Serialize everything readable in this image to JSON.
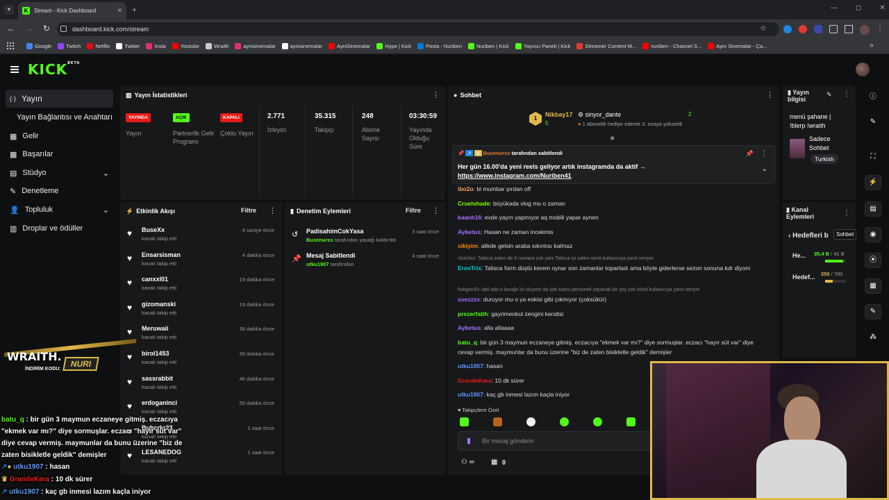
{
  "browser": {
    "tab_title": "Stream - Kick Dashboard",
    "url": "dashboard.kick.com/stream",
    "bookmarks": [
      {
        "label": "Google",
        "color": "#4285f4"
      },
      {
        "label": "Twitch",
        "color": "#9146ff"
      },
      {
        "label": "Netflix",
        "color": "#e50914"
      },
      {
        "label": "Twitter",
        "color": "#ffffff"
      },
      {
        "label": "Insta",
        "color": "#e1306c"
      },
      {
        "label": "Youtube",
        "color": "#ff0000"
      },
      {
        "label": "Wraith",
        "color": "#cccccc"
      },
      {
        "label": "aynisinemalar",
        "color": "#e1306c"
      },
      {
        "label": "aynisinemalar",
        "color": "#ffffff"
      },
      {
        "label": "AyniSinemalar",
        "color": "#ff0000"
      },
      {
        "label": "Hype | Kick",
        "color": "#53fc18"
      },
      {
        "label": "Posta - Nuriben",
        "color": "#0078d4"
      },
      {
        "label": "Nuriben | Kick",
        "color": "#53fc18"
      },
      {
        "label": "Yayıncı Paneli | Kick",
        "color": "#53fc18"
      },
      {
        "label": "Streamer Content M...",
        "color": "#e53935"
      },
      {
        "label": "nuriben - Channel S...",
        "color": "#ff0000"
      },
      {
        "label": "Aynı Sinemalar - Ça...",
        "color": "#ff0000"
      }
    ]
  },
  "app": {
    "logo": "KICK",
    "logo_beta": "BETA"
  },
  "sidebar": {
    "items": [
      {
        "label": "Yayın",
        "icon": "broadcast-icon"
      },
      {
        "label": "Yayın Bağlantısı ve Anahtarı",
        "icon": ""
      },
      {
        "label": "Gelir",
        "icon": "income-icon"
      },
      {
        "label": "Başarılar",
        "icon": "achievements-icon"
      },
      {
        "label": "Stüdyo",
        "icon": "studio-icon"
      },
      {
        "label": "Denetleme",
        "icon": "moderation-icon"
      },
      {
        "label": "Topluluk",
        "icon": "community-icon"
      },
      {
        "label": "Droplar ve ödüller",
        "icon": "drops-icon"
      }
    ]
  },
  "stats": {
    "title": "Yayın İstatistikleri",
    "items": [
      {
        "badge": "YAYINDA",
        "badge_color": "#e91916",
        "label": "Yayın"
      },
      {
        "badge": "AÇIK",
        "badge_color": "#53fc18",
        "label": "Partnerlik Gelir Programı"
      },
      {
        "badge": "KAPALI",
        "badge_color": "#e91916",
        "label": "Çoklu Yayın"
      },
      {
        "value": "2.771",
        "label": "İzleyici"
      },
      {
        "value": "35.315",
        "label": "Takipçi"
      },
      {
        "value": "248",
        "label": "Abone Sayısı"
      },
      {
        "value": "03:30:59",
        "label": "Yayında Olduğu Süre"
      }
    ]
  },
  "activity": {
    "title": "Etkinlik Akışı",
    "filter": "Filtre",
    "sub": "kanalı takip etti",
    "events": [
      {
        "name": "BuseXx",
        "time": "4 saniye önce"
      },
      {
        "name": "Ensarsisman",
        "time": "4 dakika önce"
      },
      {
        "name": "canxxl01",
        "time": "19 dakika önce"
      },
      {
        "name": "gizomanski",
        "time": "19 dakika önce"
      },
      {
        "name": "Meruwaii",
        "time": "38 dakika önce"
      },
      {
        "name": "birol1453",
        "time": "39 dakika önce"
      },
      {
        "name": "sassrabbit",
        "time": "46 dakika önce"
      },
      {
        "name": "erdoganinci",
        "time": "55 dakika önce"
      },
      {
        "name": "Buhcrkr23",
        "time": "1 saat önce"
      },
      {
        "name": "LESANEDOG",
        "time": "1 saat önce"
      }
    ]
  },
  "modlog": {
    "title": "Denetim Eylemleri",
    "filter": "Filtre",
    "items": [
      {
        "name": "PadisahimCokYasa",
        "by": "Busenurss",
        "action": "tarafından yasağı kaldırıldı",
        "time": "3 saat önce"
      },
      {
        "name": "Mesaj Sabitlendi",
        "by": "utku1907",
        "action": "tarafından",
        "time": "4 saat önce"
      }
    ]
  },
  "chat": {
    "title": "Sohbet",
    "gifter": {
      "name": "Nikbay17",
      "count": "5",
      "rank": "1"
    },
    "gifter2": {
      "name": "sinyor_dante",
      "count": "2",
      "note": "1 abonelik hediye ederek 3. sıraya yükseldi"
    },
    "pinned": {
      "by": "Busenurss",
      "by_suffix": "tarafından sabitlendi",
      "text": "Her gün 16.00'da yeni reels geliyor artık instagramda da aktif →",
      "link": "https://www.instagram.com/Nuriben41"
    },
    "messages": [
      {
        "user": "ibo2o",
        "color": "#f4a460",
        "text": "bi mumbar şırdan off"
      },
      {
        "user": "Cruelshade",
        "color": "#7fff00",
        "text": "büyükada vlog mu o zaman"
      },
      {
        "user": "kaanh16",
        "color": "#a970ff",
        "text": "evde yayın yapmıyor aq mobili yapar aynen"
      },
      {
        "user": "Aybetus",
        "color": "#a970ff",
        "text": "Hasan ne zaman incekmis"
      },
      {
        "user": "sikiyim",
        "color": "#ff8c00",
        "text": "alikde gelsin araba sıkıntısı kalmaz"
      },
      {
        "user": "ErenTrix",
        "color": "#00ced1",
        "text": "Talisca form düştü kerem oynar son zamanlar toparladı ama böyle giderlerse sezon sonuna kdr diyom"
      },
      {
        "user": "suezzzx",
        "color": "#a970ff",
        "text": "duruyor mu o ya eskisi gibi çıkmıyor (çoksükür)"
      },
      {
        "user": "prezerfatih",
        "color": "#53fc18",
        "text": "gayrimenkul zengini kendisi"
      },
      {
        "user": "Aybetus",
        "color": "#a970ff",
        "text": "alla allaaaa"
      },
      {
        "user": "batu_q",
        "color": "#53fc18",
        "text": "bir gün 3 maymun eczaneye gitmiş. eczacıya \"ekmek var mı?\" diye sormuşlar. eczacı \"hayır süt var\" diye cevap vermiş. maymunlar da bunu üzerine \"biz de zaten bisikletle geldik\" demişler"
      },
      {
        "user": "utku1907",
        "color": "#5b9bff",
        "text": "hasan"
      },
      {
        "user": "GrandeKara",
        "color": "#e91916",
        "text": "10 dk sürer"
      },
      {
        "user": "utku1907",
        "color": "#5b9bff",
        "text": "kaç gb inmesi lazım kaçla iniyor"
      }
    ],
    "replies": [
      "clutchss: Talisca zaten de 9 numara yok yani Talisca iyi zaten isimli kullanıcıya yanıt veriyor",
      "holigan43: tabi tabi o lavuğa kıl oluyom da işte kamu personeli yapacak bir şey yok isimli kullanıcıya yanıt veriyor"
    ],
    "followers_only": "Takipçilere Özel",
    "input_placeholder": "Bir mesaj gönderin",
    "footer_count": "0"
  },
  "stream_info": {
    "title": "Yayın bilgisi",
    "text": "menü şahane | !blerp !wraith",
    "mode": "Sadece Sohbet",
    "language": "Turkish"
  },
  "channel_actions": {
    "title": "Kanal Eylemleri",
    "goals": "Hedefleri b",
    "tooltip": "Sohbet",
    "goal1": {
      "label": "He...",
      "value": "35,4 B",
      "total": "/ 41 B",
      "fraction": 0.86
    },
    "goal2": {
      "label": "Hedef...",
      "value": "250",
      "total": "/ 700",
      "fraction": 0.36
    }
  },
  "overlay": {
    "brand": "WRAITH.",
    "code_label": "İNDİRİM KODU:",
    "code": "NURI",
    "lines": [
      {
        "user": "batu_q",
        "text": "bir gün 3 maymun eczaneye gitmiş. eczacıya \"ekmek var mı?\" diye sormuşlar. eczacı \"hayır süt var\" diye cevap vermiş. maymunlar da bunu üzerine \"biz de zaten bisikletle geldik\" demişler"
      },
      {
        "user": "utku1907",
        "text": "hasan"
      },
      {
        "user": "GrandeKara",
        "text": "10 dk sürer"
      },
      {
        "user": "utku1907",
        "text": "kaç gb inmesi lazım kaçla iniyor"
      }
    ]
  }
}
